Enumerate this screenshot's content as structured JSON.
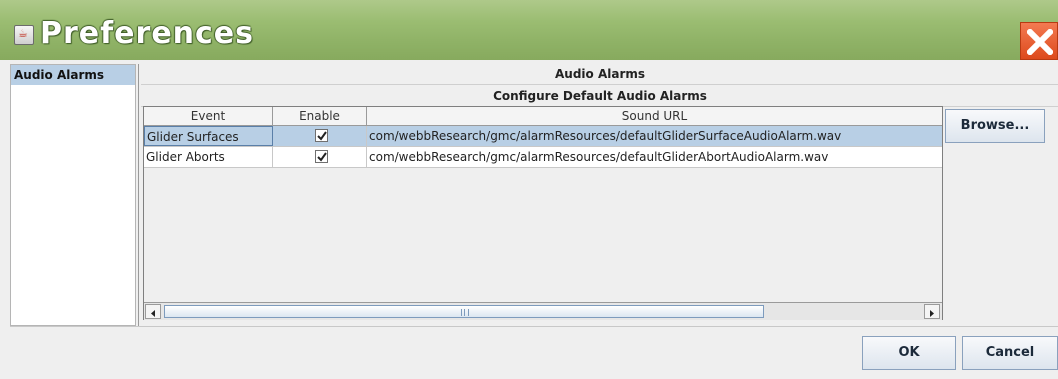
{
  "window": {
    "title": "Preferences",
    "accent_color": "#9bbd72",
    "close_color": "#e8572b",
    "icons": {
      "app": "java-cup-icon",
      "close": "close-x-icon"
    }
  },
  "sidebar": {
    "items": [
      {
        "label": "Audio Alarms",
        "selected": true
      }
    ]
  },
  "panel": {
    "title": "Audio Alarms",
    "subtitle": "Configure Default Audio Alarms"
  },
  "table": {
    "columns": [
      "Event",
      "Enable",
      "Sound URL"
    ],
    "rows": [
      {
        "event": "Glider Surfaces",
        "enabled": true,
        "sound_url": "com/webbResearch/gmc/alarmResources/defaultGliderSurfaceAudioAlarm.wav",
        "selected": true
      },
      {
        "event": "Glider Aborts",
        "enabled": true,
        "sound_url": "com/webbResearch/gmc/alarmResources/defaultGliderAbortAudioAlarm.wav",
        "selected": false
      }
    ],
    "selection_color": "#b8cfe5"
  },
  "buttons": {
    "browse": "Browse...",
    "ok": "OK",
    "cancel": "Cancel"
  }
}
